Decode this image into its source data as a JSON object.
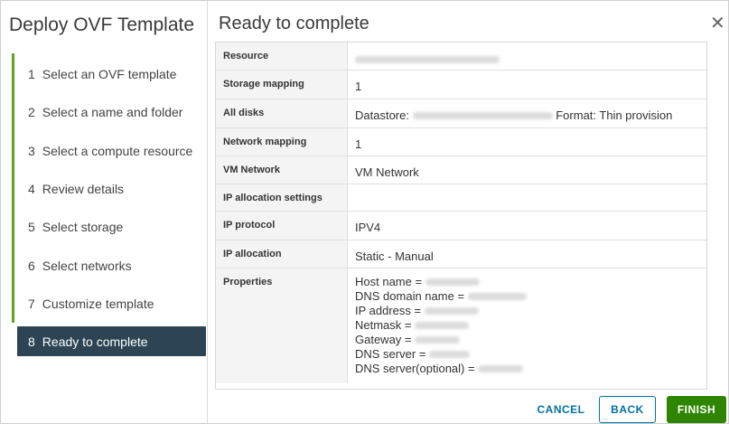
{
  "wizard": {
    "title": "Deploy OVF Template",
    "steps": [
      {
        "num": "1",
        "label": "Select an OVF template"
      },
      {
        "num": "2",
        "label": "Select a name and folder"
      },
      {
        "num": "3",
        "label": "Select a compute resource"
      },
      {
        "num": "4",
        "label": "Review details"
      },
      {
        "num": "5",
        "label": "Select storage"
      },
      {
        "num": "6",
        "label": "Select networks"
      },
      {
        "num": "7",
        "label": "Customize template"
      },
      {
        "num": "8",
        "label": "Ready to complete"
      }
    ],
    "active_step": 8
  },
  "page": {
    "title": "Ready to complete",
    "close_icon": "close-icon"
  },
  "summary": {
    "resource": {
      "key": "Resource",
      "value": ""
    },
    "storage_mapping": {
      "key": "Storage mapping",
      "value": "1"
    },
    "all_disks": {
      "key": "All disks",
      "prefix": "Datastore:",
      "suffix": "Format: Thin provision"
    },
    "network_mapping": {
      "key": "Network mapping",
      "value": "1"
    },
    "vm_network": {
      "key": "VM Network",
      "value": "VM Network"
    },
    "ip_alloc_settings": {
      "key": "IP allocation settings",
      "value": ""
    },
    "ip_protocol": {
      "key": "IP protocol",
      "value": "IPV4"
    },
    "ip_allocation": {
      "key": "IP allocation",
      "value": "Static - Manual"
    },
    "properties": {
      "key": "Properties",
      "lines": [
        "Host name =",
        "DNS domain name =",
        "IP address =",
        "Netmask =",
        "Gateway =",
        "DNS server =",
        "DNS server(optional) ="
      ]
    }
  },
  "footer": {
    "cancel": "CANCEL",
    "back": "BACK",
    "finish": "FINISH"
  },
  "colors": {
    "active_step_bg": "#2c4453",
    "progress_bar": "#62a420",
    "primary_blue": "#0072a3",
    "finish_green": "#2e8500"
  }
}
